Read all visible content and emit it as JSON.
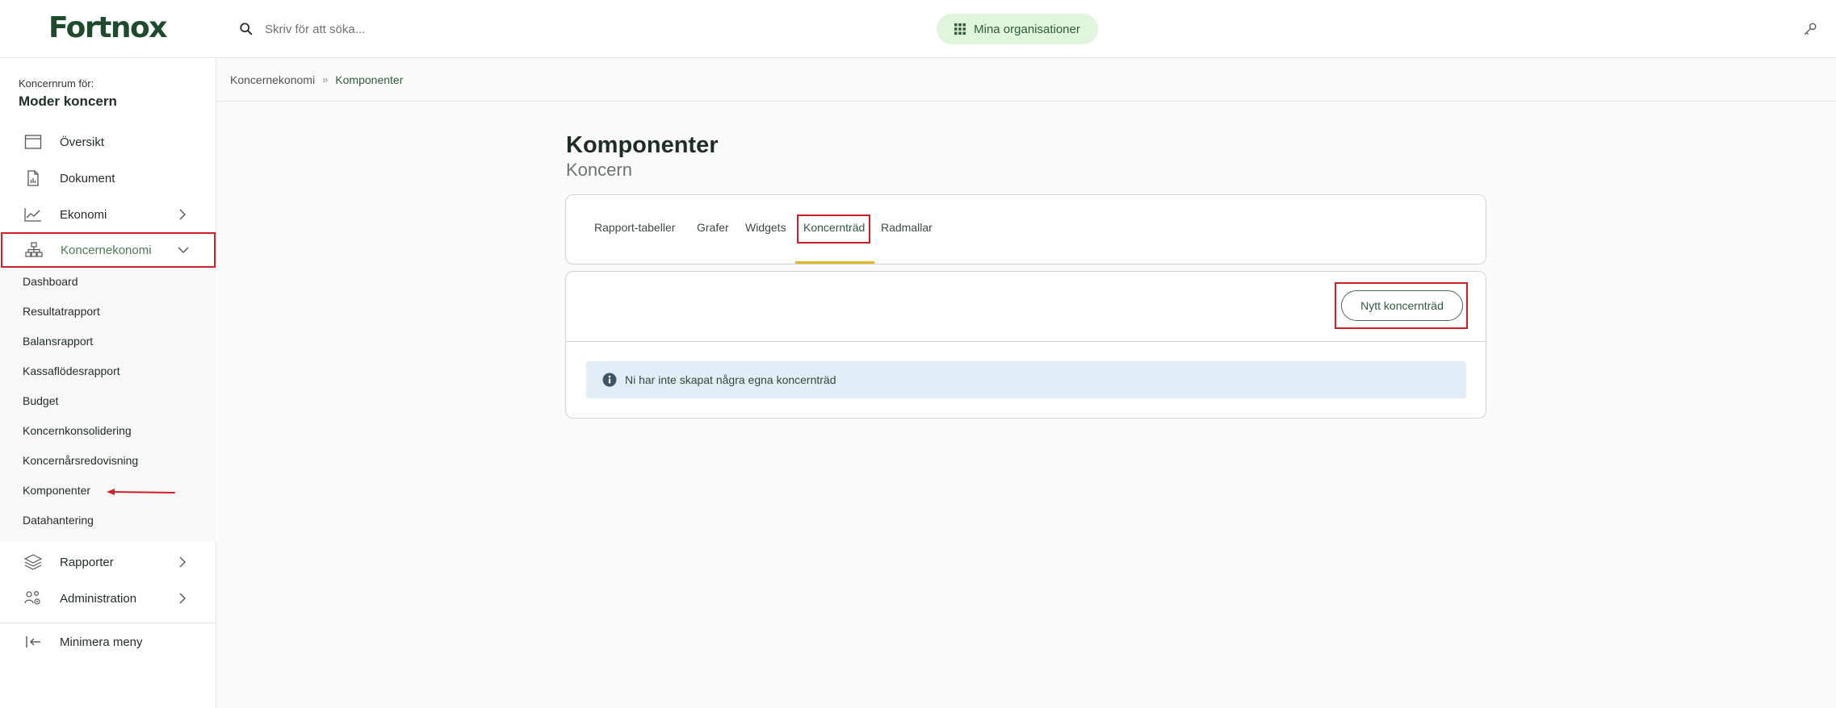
{
  "header": {
    "logo_text": "Fortnox",
    "search_placeholder": "Skriv för att söka...",
    "orgs_button": "Mina organisationer"
  },
  "sidebar": {
    "org_label": "Koncernrum för:",
    "org_name": "Moder koncern",
    "items": [
      {
        "label": "Översikt",
        "icon": "window-icon"
      },
      {
        "label": "Dokument",
        "icon": "document-chart-icon"
      },
      {
        "label": "Ekonomi",
        "icon": "line-chart-icon"
      },
      {
        "label": "Koncernekonomi",
        "icon": "org-tree-icon"
      },
      {
        "label": "Rapporter",
        "icon": "layers-icon"
      },
      {
        "label": "Administration",
        "icon": "users-gear-icon"
      }
    ],
    "sub_items": [
      "Dashboard",
      "Resultatrapport",
      "Balansrapport",
      "Kassaflödesrapport",
      "Budget",
      "Koncernkonsolidering",
      "Koncernårsredovisning",
      "Komponenter",
      "Datahantering"
    ],
    "minimize_label": "Minimera meny"
  },
  "breadcrumb": {
    "parent": "Koncernekonomi",
    "current": "Komponenter"
  },
  "page": {
    "title": "Komponenter",
    "subtitle": "Koncern"
  },
  "tabs": [
    "Rapport-tabeller",
    "Grafer",
    "Widgets",
    "Koncernträd",
    "Radmallar"
  ],
  "active_tab": "Koncernträd",
  "content": {
    "new_button": "Nytt koncernträd",
    "info_message": "Ni har inte skapat några egna koncernträd"
  },
  "colors": {
    "brand_green": "#1e4b2e",
    "annotation_red": "#d21f26",
    "tab_underline": "#e2b529",
    "info_bg": "#e1eef8",
    "orgs_pill_bg": "#dff5dc"
  }
}
